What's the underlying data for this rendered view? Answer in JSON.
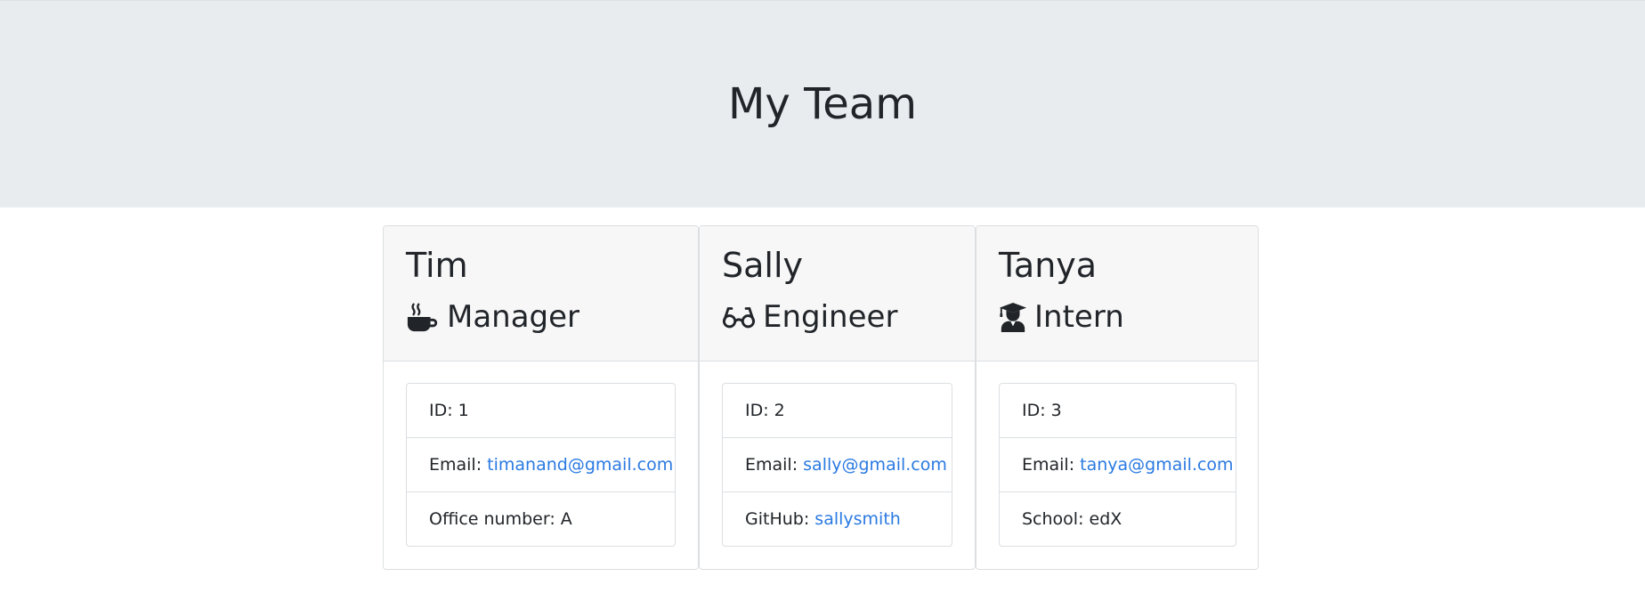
{
  "header": {
    "title": "My Team"
  },
  "team": [
    {
      "name": "Tim",
      "role": "Manager",
      "icon": "coffee-icon",
      "id_label": "ID: 1",
      "email_prefix": "Email: ",
      "email": "timanand@gmail.com",
      "extra_prefix": "Office number: A",
      "extra_value": ""
    },
    {
      "name": "Sally",
      "role": "Engineer",
      "icon": "glasses-icon",
      "id_label": "ID: 2",
      "email_prefix": "Email: ",
      "email": "sally@gmail.com",
      "extra_prefix": "GitHub: ",
      "extra_value": "sallysmith"
    },
    {
      "name": "Tanya",
      "role": "Intern",
      "icon": "graduate-icon",
      "id_label": "ID: 3",
      "email_prefix": "Email: ",
      "email": "tanya@gmail.com",
      "extra_prefix": "School: edX",
      "extra_value": ""
    }
  ],
  "colors": {
    "header_bg": "#e9ecef",
    "card_header_bg": "#f7f7f7",
    "link": "#2a7ae2",
    "text": "#212529"
  }
}
